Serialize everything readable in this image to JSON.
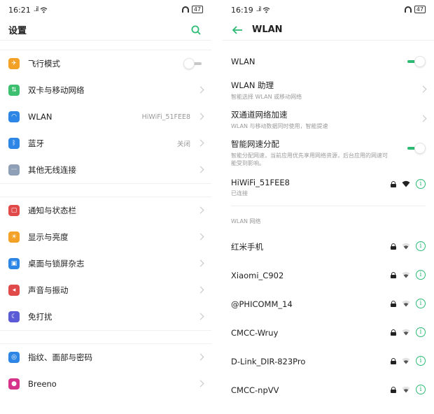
{
  "left": {
    "status": {
      "time": "16:21",
      "signal": "..il",
      "battery": "47"
    },
    "title": "设置",
    "groups": [
      [
        {
          "label": "飞行模式",
          "icon": "airplane-icon",
          "color": "#f4a227",
          "control": "toggle-off",
          "value": ""
        },
        {
          "label": "双卡与移动网络",
          "icon": "sim-dual-icon",
          "color": "#3cbf6e",
          "control": "chevron",
          "value": ""
        },
        {
          "label": "WLAN",
          "icon": "wifi-icon",
          "color": "#2d86e6",
          "control": "chevron",
          "value": "HiWiFi_51FEE8"
        },
        {
          "label": "蓝牙",
          "icon": "bluetooth-icon",
          "color": "#2d86e6",
          "control": "chevron",
          "value": "关闭"
        },
        {
          "label": "其他无线连接",
          "icon": "more-connections-icon",
          "color": "#8e9fb6",
          "control": "chevron",
          "value": ""
        }
      ],
      [
        {
          "label": "通知与状态栏",
          "icon": "notification-icon",
          "color": "#e04a4a",
          "control": "chevron",
          "value": ""
        },
        {
          "label": "显示与亮度",
          "icon": "brightness-icon",
          "color": "#f4a227",
          "control": "chevron",
          "value": ""
        },
        {
          "label": "桌面与锁屏杂志",
          "icon": "wallpaper-icon",
          "color": "#2d86e6",
          "control": "chevron",
          "value": ""
        },
        {
          "label": "声音与振动",
          "icon": "sound-icon",
          "color": "#e04a4a",
          "control": "chevron",
          "value": ""
        },
        {
          "label": "免打扰",
          "icon": "moon-icon",
          "color": "#5a5ad6",
          "control": "chevron",
          "value": ""
        }
      ],
      [
        {
          "label": "指纹、面部与密码",
          "icon": "fingerprint-icon",
          "color": "#2d86e6",
          "control": "chevron",
          "value": ""
        },
        {
          "label": "Breeno",
          "icon": "breeno-icon",
          "color": "#d6338a",
          "control": "chevron",
          "value": ""
        }
      ]
    ]
  },
  "right": {
    "status": {
      "time": "16:19",
      "signal": "..il",
      "battery": "47"
    },
    "title": "WLAN",
    "wlan_label": "WLAN",
    "assistant": {
      "title": "WLAN 助理",
      "subtitle": "智能选择 WLAN 或移动网络"
    },
    "dual_channel": {
      "title": "双通道网络加速",
      "subtitle": "WLAN 与移动数据同时使用，智能提速"
    },
    "smart_speed": {
      "title": "智能网速分配",
      "subtitle": "智能分配网速，当前应用优先享用网络资源，后台应用的网速可能受到影响。"
    },
    "connected": {
      "name": "HiWiFi_51FEE8",
      "status": "已连接"
    },
    "section_caption": "WLAN 网络",
    "networks": [
      {
        "name": "红米手机"
      },
      {
        "name": "Xiaomi_C902"
      },
      {
        "name": "@PHICOMM_14"
      },
      {
        "name": "CMCC-Wruy"
      },
      {
        "name": "D-Link_DIR-823Pro"
      },
      {
        "name": "CMCC-npVV"
      }
    ]
  },
  "colors": {
    "accent": "#2dbb74"
  }
}
